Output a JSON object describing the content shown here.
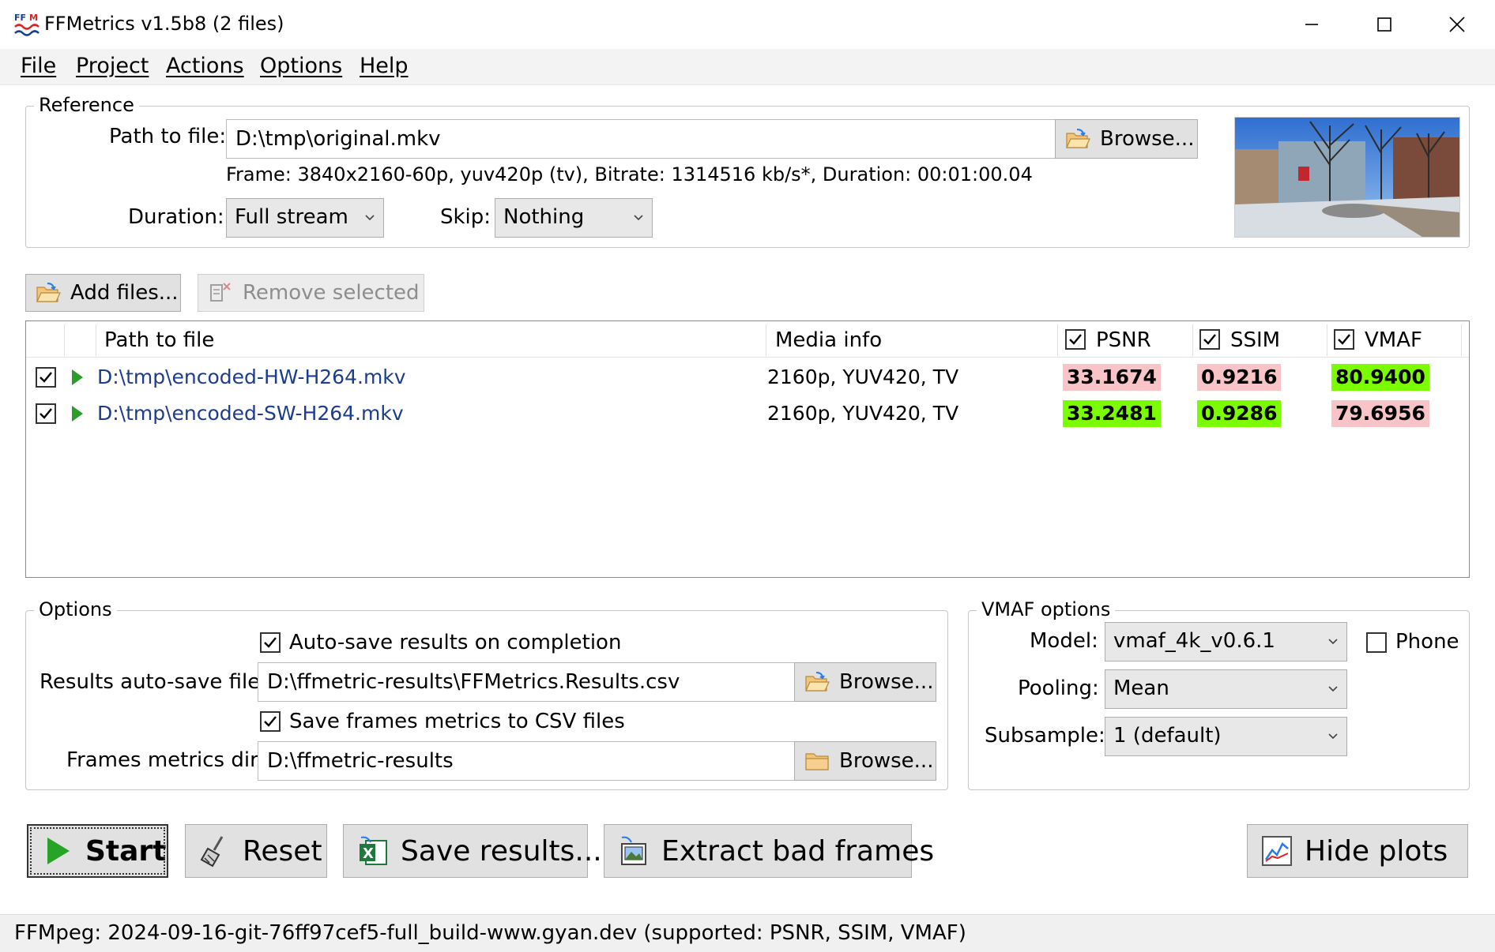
{
  "window": {
    "title": "FFMetrics v1.5b8 (2 files)",
    "minimize_glyph": "—",
    "icon": "ffm-app-icon"
  },
  "menu": [
    {
      "label": "File"
    },
    {
      "label": "Project"
    },
    {
      "label": "Actions"
    },
    {
      "label": "Options"
    },
    {
      "label": "Help"
    }
  ],
  "reference": {
    "legend": "Reference",
    "path_label": "Path to file:",
    "path_value": "D:\\tmp\\original.mkv",
    "browse_label": "Browse...",
    "frame_info": "Frame: 3840x2160-60p, yuv420p (tv), Bitrate: 1314516 kb/s*, Duration: 00:01:00.04",
    "duration_label": "Duration:",
    "duration_value": "Full stream",
    "skip_label": "Skip:",
    "skip_value": "Nothing"
  },
  "toolbar": {
    "add_files_label": "Add files...",
    "remove_selected_label": "Remove selected"
  },
  "file_list": {
    "columns": {
      "path": "Path to file",
      "media_info": "Media info",
      "psnr": "PSNR",
      "ssim": "SSIM",
      "vmaf": "VMAF"
    },
    "rows": [
      {
        "path": "D:\\tmp\\encoded-HW-H264.mkv",
        "media_info": "2160p, YUV420, TV",
        "psnr": "33.1674",
        "ssim": "0.9216",
        "vmaf": "80.9400"
      },
      {
        "path": "D:\\tmp\\encoded-SW-H264.mkv",
        "media_info": "2160p, YUV420, TV",
        "psnr": "33.2481",
        "ssim": "0.9286",
        "vmaf": "79.6956"
      }
    ],
    "colors": {
      "best": "#7cfc00",
      "worse": "#f8c4c8"
    }
  },
  "options": {
    "legend": "Options",
    "autosave_label": "Auto-save results on completion",
    "results_file_label": "Results auto-save file:",
    "results_file_value": "D:\\ffmetric-results\\FFMetrics.Results.csv",
    "browse_label": "Browse...",
    "save_frames_label": "Save frames metrics to CSV files",
    "frames_dir_label": "Frames metrics dir:",
    "frames_dir_value": "D:\\ffmetric-results"
  },
  "vmaf_options": {
    "legend": "VMAF options",
    "model_label": "Model:",
    "model_value": "vmaf_4k_v0.6.1",
    "phone_label": "Phone",
    "pooling_label": "Pooling:",
    "pooling_value": "Mean",
    "subsample_label": "Subsample:",
    "subsample_value": "1 (default)"
  },
  "actions": {
    "start_label": "Start",
    "reset_label": "Reset",
    "save_results_label": "Save results...",
    "extract_bad_frames_label": "Extract bad frames",
    "hide_plots_label": "Hide plots"
  },
  "status": {
    "text": "FFMpeg: 2024-09-16-git-76ff97cef5-full_build-www.gyan.dev (supported: PSNR, SSIM, VMAF)"
  }
}
